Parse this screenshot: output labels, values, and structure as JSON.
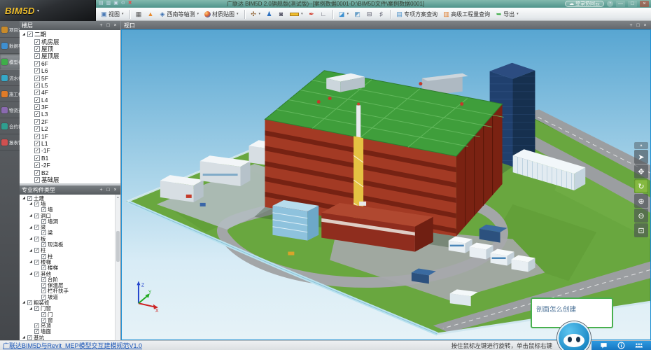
{
  "window": {
    "logo": "BIM5D",
    "title": "广联达 BIM5D 2.0旗舰版(测试版)--[案例数据0001-D:\\BIM5D文件\\案例数据0001]",
    "login_button": "登录协同云"
  },
  "toolbar": {
    "items": [
      {
        "name": "view",
        "icon": "monitor",
        "label": "视图",
        "dropdown": true
      },
      {
        "sep": true
      },
      {
        "name": "axis-net",
        "icon": "axisgrid"
      },
      {
        "name": "top-view",
        "icon": "topview"
      },
      {
        "name": "view-direction",
        "icon": "cube",
        "label": "西南等轴测",
        "dropdown": true
      },
      {
        "name": "display-mode",
        "icon": "sphere",
        "label": "材质贴图",
        "dropdown": true
      },
      {
        "sep": true
      },
      {
        "name": "roam",
        "icon": "walk",
        "dropdown": true
      },
      {
        "name": "viewpoint",
        "icon": "person"
      },
      {
        "name": "snapshot",
        "icon": "camera"
      },
      {
        "name": "measure",
        "icon": "ruler",
        "dropdown": true
      },
      {
        "name": "markup",
        "icon": "marker"
      },
      {
        "name": "height-measure",
        "icon": "vruler"
      },
      {
        "sep": true
      },
      {
        "name": "section",
        "icon": "slice",
        "dropdown": true
      },
      {
        "name": "section-plane",
        "icon": "slice2"
      },
      {
        "name": "section-box",
        "icon": "sectionbox"
      },
      {
        "name": "grid-lines",
        "icon": "hash"
      },
      {
        "sep": true
      },
      {
        "name": "special-plan-query",
        "icon": "doc",
        "label": "专项方案查询"
      },
      {
        "name": "advanced-quantity-query",
        "icon": "calc",
        "label": "高级工程量查询"
      },
      {
        "name": "export",
        "icon": "exporticon",
        "label": "导出",
        "dropdown": true
      }
    ]
  },
  "sidebar": {
    "items": [
      {
        "name": "project-info",
        "label": "项目资料",
        "color": "#c88a2a"
      },
      {
        "name": "data-import",
        "label": "数据导入",
        "color": "#3f8fd0"
      },
      {
        "name": "model-view",
        "label": "模型视图",
        "color": "#3fae49",
        "active": true
      },
      {
        "name": "flow-view",
        "label": "流水视图",
        "color": "#35a8c8"
      },
      {
        "name": "construction-simulation",
        "label": "施工模拟",
        "color": "#e07b28"
      },
      {
        "name": "material-query",
        "label": "物资查询",
        "color": "#8a6ab0"
      },
      {
        "name": "contract-view",
        "label": "合约视图",
        "color": "#2f9e8f"
      },
      {
        "name": "report-management",
        "label": "报表管理",
        "color": "#d05050"
      }
    ]
  },
  "floors_panel": {
    "title": "楼层",
    "items": [
      {
        "label": "二期",
        "level": 0,
        "expand": true
      },
      {
        "label": "机房层",
        "level": 1
      },
      {
        "label": "屋顶",
        "level": 1
      },
      {
        "label": "屋顶层",
        "level": 1
      },
      {
        "label": "6F",
        "level": 1
      },
      {
        "label": "L6",
        "level": 1
      },
      {
        "label": "5F",
        "level": 1
      },
      {
        "label": "L5",
        "level": 1
      },
      {
        "label": "4F",
        "level": 1
      },
      {
        "label": "L4",
        "level": 1
      },
      {
        "label": "3F",
        "level": 1
      },
      {
        "label": "L3",
        "level": 1
      },
      {
        "label": "2F",
        "level": 1
      },
      {
        "label": "L2",
        "level": 1
      },
      {
        "label": "1F",
        "level": 1
      },
      {
        "label": "L1",
        "level": 1
      },
      {
        "label": "-1F",
        "level": 1
      },
      {
        "label": "B1",
        "level": 1
      },
      {
        "label": "-2F",
        "level": 1
      },
      {
        "label": "B2",
        "level": 1
      },
      {
        "label": "基础层",
        "level": 1
      }
    ]
  },
  "components_panel": {
    "title": "专业构件类型",
    "items": [
      {
        "label": "土建",
        "level": 0,
        "expand": true
      },
      {
        "label": "墙",
        "level": 1,
        "expand": true
      },
      {
        "label": "墙",
        "level": 2
      },
      {
        "label": "洞口",
        "level": 1,
        "expand": true
      },
      {
        "label": "墙洞",
        "level": 2
      },
      {
        "label": "梁",
        "level": 1,
        "expand": true
      },
      {
        "label": "梁",
        "level": 2
      },
      {
        "label": "板",
        "level": 1,
        "expand": true
      },
      {
        "label": "现浇板",
        "level": 2
      },
      {
        "label": "柱",
        "level": 1,
        "expand": true
      },
      {
        "label": "柱",
        "level": 2
      },
      {
        "label": "楼梯",
        "level": 1,
        "expand": true
      },
      {
        "label": "楼梯",
        "level": 2
      },
      {
        "label": "其他",
        "level": 1,
        "expand": true
      },
      {
        "label": "台阶",
        "level": 2
      },
      {
        "label": "保温层",
        "level": 2
      },
      {
        "label": "栏杆扶手",
        "level": 2
      },
      {
        "label": "坡道",
        "level": 2
      },
      {
        "label": "粗装修",
        "level": 0,
        "expand": true
      },
      {
        "label": "门窗",
        "level": 1,
        "expand": true
      },
      {
        "label": "门",
        "level": 2
      },
      {
        "label": "窗",
        "level": 2
      },
      {
        "label": "吊顶",
        "level": 1
      },
      {
        "label": "墙面",
        "level": 1
      },
      {
        "label": "基坑",
        "level": 0,
        "expand": true
      }
    ]
  },
  "viewport": {
    "title": "视口",
    "axes": {
      "x": "X",
      "y": "Y",
      "z": "Z"
    },
    "tools": [
      {
        "name": "select",
        "icon": "cursor"
      },
      {
        "name": "pan",
        "icon": "hand"
      },
      {
        "name": "orbit",
        "icon": "orbit",
        "active": true
      },
      {
        "name": "zoom-in",
        "icon": "zoomin"
      },
      {
        "name": "zoom-out",
        "icon": "zoomout"
      },
      {
        "name": "zoom-window",
        "icon": "zoomwin"
      }
    ]
  },
  "assistant": {
    "tooltip": "剖面怎么创建"
  },
  "statusbar": {
    "link": "广联达BIM5D与Revit_MEP模型交互建模规范V1.0",
    "hint": "按住鼠标左键进行旋转，单击鼠标右键"
  },
  "colors": {
    "accent_blue": "#1e8fd5",
    "active_green": "#8bc34a",
    "title_teal": "#5b9a91",
    "building_red": "#a33a24",
    "roof_green": "#3f9e3b"
  }
}
